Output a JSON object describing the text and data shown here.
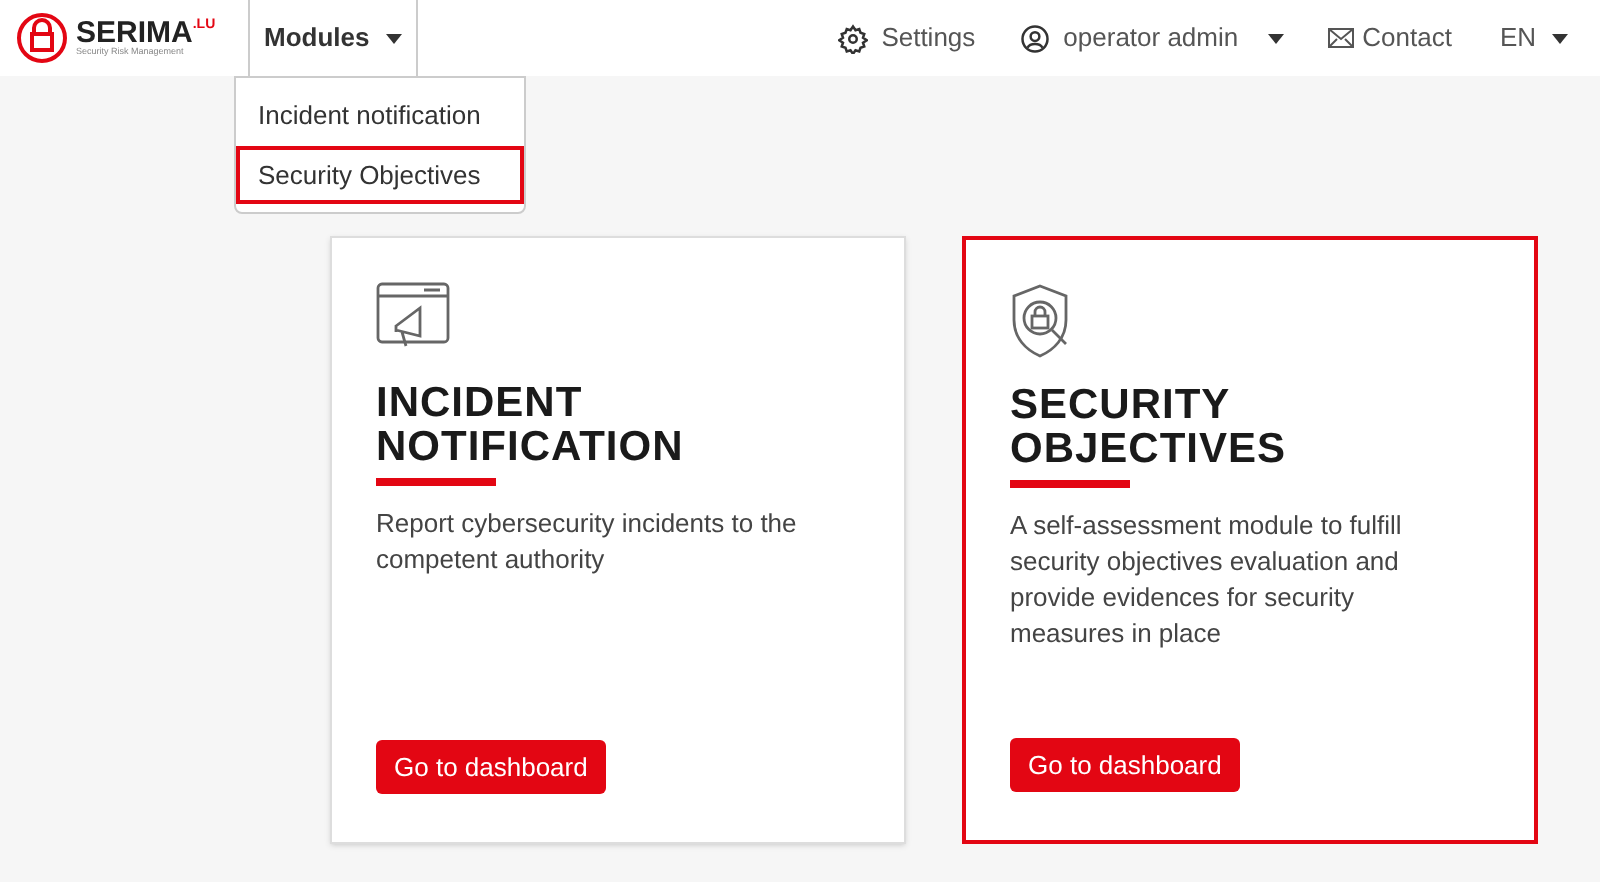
{
  "logo": {
    "name": "SERIMA",
    "suffix": ".LU",
    "tagline": "Security Risk Management"
  },
  "nav": {
    "modules": {
      "label": "Modules",
      "expanded": true,
      "items": [
        {
          "label": "Incident notification",
          "highlighted": false
        },
        {
          "label": "Security Objectives",
          "highlighted": true
        }
      ]
    },
    "settings": "Settings",
    "user": "operator admin",
    "contact": "Contact",
    "language": "EN"
  },
  "cards": [
    {
      "kind": "incident",
      "title_lines": [
        "INCIDENT",
        "NOTIFICATION"
      ],
      "description": "Report cybersecurity incidents to the competent authority",
      "button": "Go to dashboard",
      "highlighted": false
    },
    {
      "kind": "security",
      "title_lines": [
        "SECURITY",
        "OBJECTIVES"
      ],
      "description": "A self-assessment module to fulfill security objectives evaluation and provide evidences for security measures in place",
      "button": "Go to dashboard",
      "highlighted": true
    }
  ]
}
